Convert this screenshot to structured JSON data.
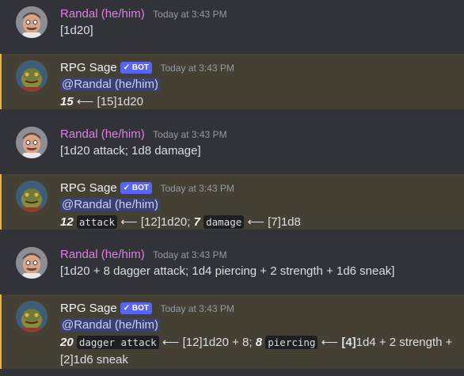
{
  "messages": [
    {
      "author": "Randal (he/him)",
      "time": "Today at 3:43 PM",
      "text": "[1d20]"
    },
    {
      "author": "RPG Sage",
      "badge": "✓ BOT",
      "time": "Today at 3:43 PM",
      "mention": "@Randal (he/him)",
      "total": "15",
      "arrow": "⟵",
      "result": "[15]1d20"
    },
    {
      "author": "Randal (he/him)",
      "time": "Today at 3:43 PM",
      "text": "[1d20 attack; 1d8 damage]"
    },
    {
      "author": "RPG Sage",
      "badge": "✓ BOT",
      "time": "Today at 3:43 PM",
      "mention": "@Randal (he/him)",
      "total1": "12",
      "label1": "attack",
      "arrow": "⟵",
      "result1": "[12]1d20;",
      "total2": "7",
      "label2": "damage",
      "result2": "[7]1d8"
    },
    {
      "author": "Randal (he/him)",
      "time": "Today at 3:43 PM",
      "text": "[1d20 + 8 dagger attack; 1d4 piercing + 2 strength + 1d6 sneak]"
    },
    {
      "author": "RPG Sage",
      "badge": "✓ BOT",
      "time": "Today at 3:43 PM",
      "mention": "@Randal (he/him)",
      "total1": "20",
      "label1": "dagger attack",
      "arrow": "⟵",
      "result1": "[12]1d20 + 8;",
      "total2": "8",
      "label2": "piercing",
      "result2_bold": "[4]",
      "result2_rest": "1d4 + 2 strength +",
      "result2_line2": "[2]1d6 sneak"
    }
  ],
  "colors": {
    "background": "#313338",
    "highlight": "#444034",
    "highlight_border": "#f0b232",
    "randal": "#e27ee6",
    "bot_badge": "#5865f2"
  }
}
